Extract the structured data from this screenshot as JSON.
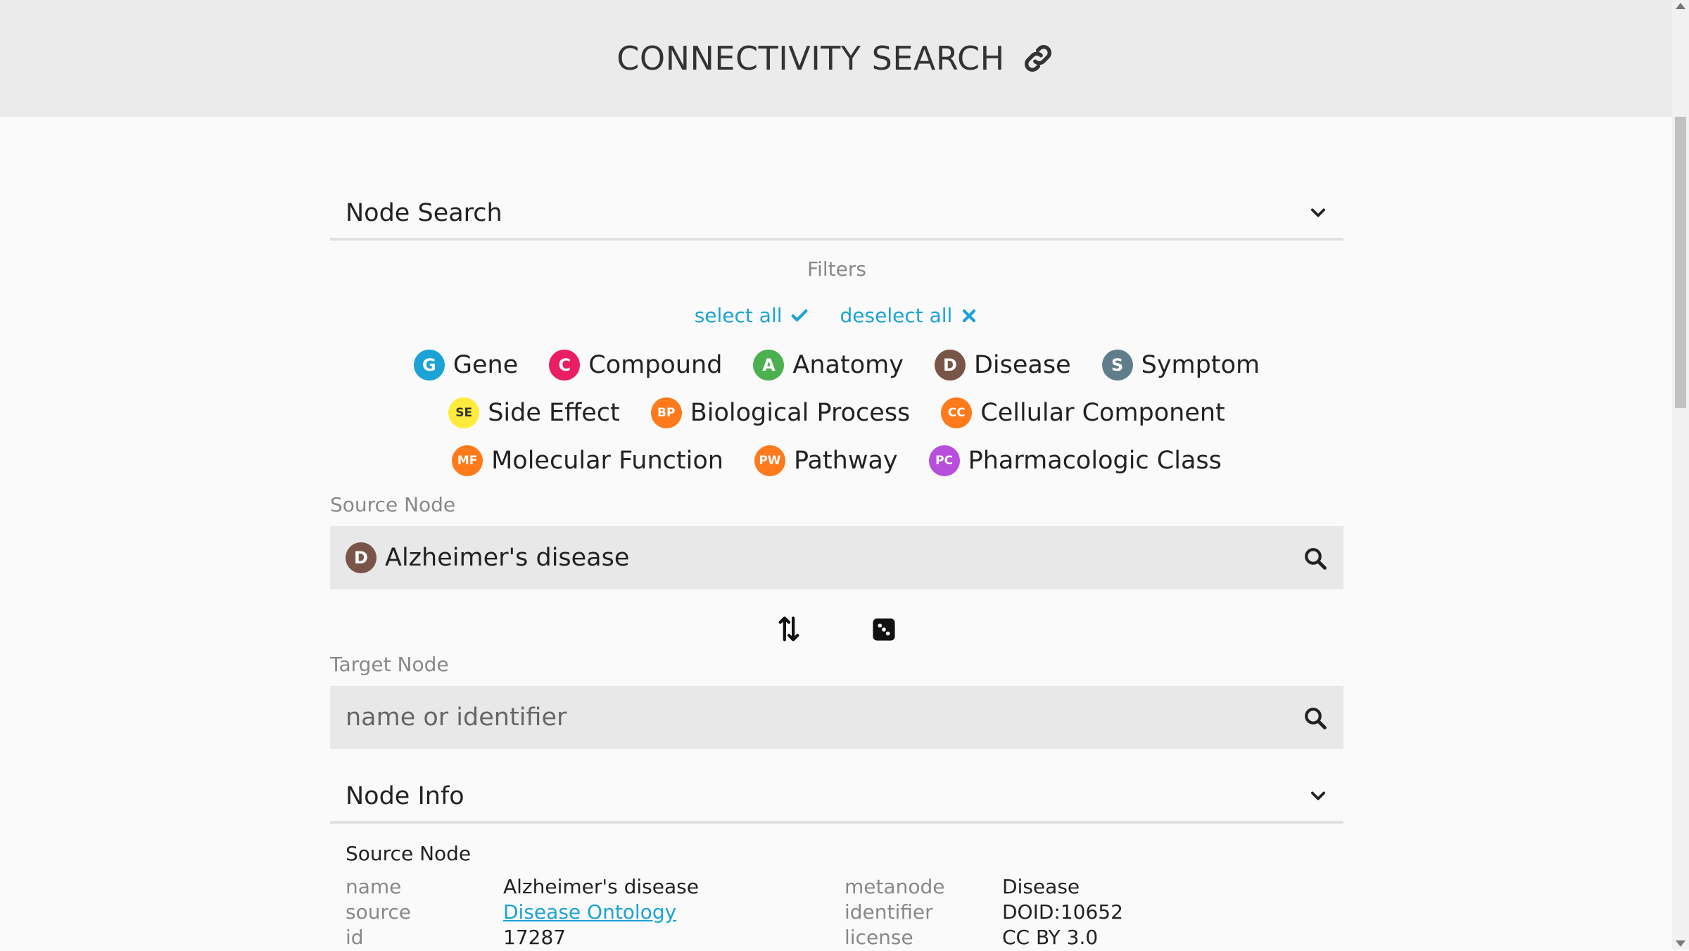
{
  "header": {
    "title": "CONNECTIVITY SEARCH"
  },
  "node_search": {
    "title": "Node Search",
    "filters_label": "Filters",
    "select_all": "select all",
    "deselect_all": "deselect all",
    "filters": [
      {
        "label": "Gene",
        "abbr": "G",
        "color": "#1ba3d6"
      },
      {
        "label": "Compound",
        "abbr": "C",
        "color": "#e91e63"
      },
      {
        "label": "Anatomy",
        "abbr": "A",
        "color": "#4caf50"
      },
      {
        "label": "Disease",
        "abbr": "D",
        "color": "#795548"
      },
      {
        "label": "Symptom",
        "abbr": "S",
        "color": "#607d8b"
      },
      {
        "label": "Side Effect",
        "abbr": "SE",
        "color": "#ffeb3b"
      },
      {
        "label": "Biological Process",
        "abbr": "BP",
        "color": "#ff7a1a"
      },
      {
        "label": "Cellular Component",
        "abbr": "CC",
        "color": "#ff7a1a"
      },
      {
        "label": "Molecular Function",
        "abbr": "MF",
        "color": "#ff7a1a"
      },
      {
        "label": "Pathway",
        "abbr": "PW",
        "color": "#ff7a1a"
      },
      {
        "label": "Pharmacologic Class",
        "abbr": "PC",
        "color": "#b84fdc"
      }
    ],
    "source_label": "Source Node",
    "source_value": "Alzheimer's disease",
    "source_abbr": "D",
    "source_color": "#795548",
    "target_label": "Target Node",
    "target_placeholder": "name or identifier"
  },
  "node_info": {
    "title": "Node Info",
    "subtitle": "Source Node",
    "rows": [
      {
        "k1": "name",
        "v1": "Alzheimer's disease",
        "k2": "metanode",
        "v2": "Disease"
      },
      {
        "k1": "source",
        "v1": "Disease Ontology",
        "k2": "identifier",
        "v2": "DOID:10652"
      },
      {
        "k1": "id",
        "v1": "17287",
        "k2": "license",
        "v2": "CC BY 3.0"
      }
    ]
  }
}
